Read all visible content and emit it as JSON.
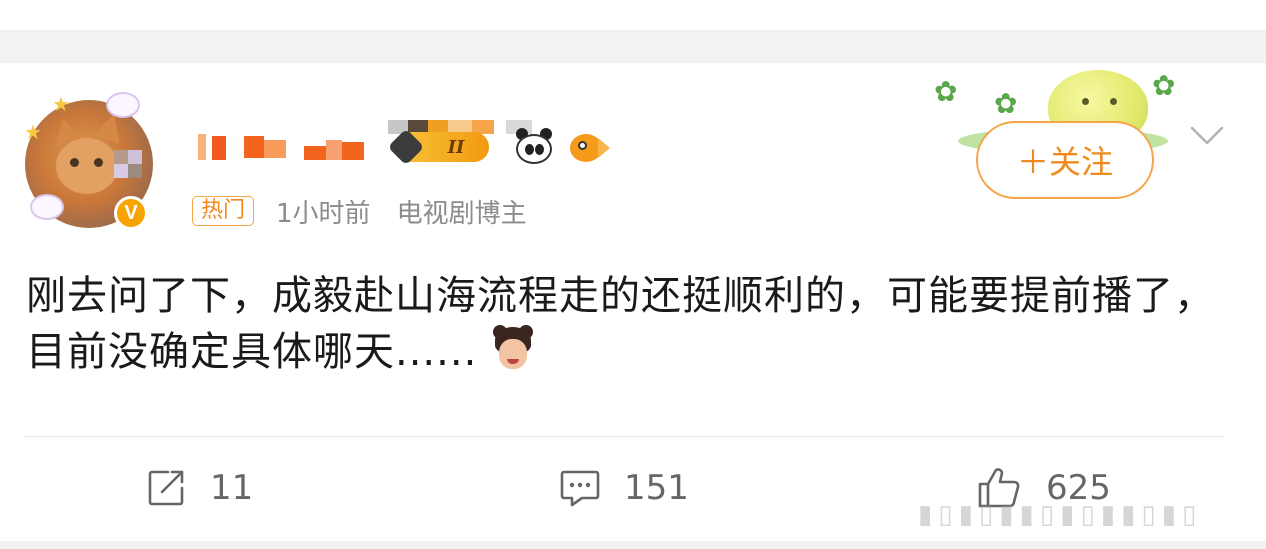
{
  "post": {
    "author": {
      "name_obscured": "████ 3.13",
      "level_badge": "II",
      "verified_mark": "V"
    },
    "meta": {
      "hot_tag": "热门",
      "time": "1小时前",
      "role": "电视剧博主"
    },
    "follow_label": "＋关注",
    "text": "刚去问了下，成毅赴山海流程走的还挺顺利的，可能要提前播了，目前没确定具体哪天......",
    "actions": {
      "repost_count": "11",
      "comment_count": "151",
      "like_count": "625"
    }
  },
  "icons": {
    "repost": "repost-icon",
    "comment": "comment-icon",
    "like": "thumbs-up-icon",
    "more": "chevron-down-icon"
  },
  "colors": {
    "accent_orange": "#f08a1c",
    "text_primary": "#1a1a1a",
    "text_secondary": "#8c8c8c",
    "separator_band": "#f2f2f2"
  }
}
